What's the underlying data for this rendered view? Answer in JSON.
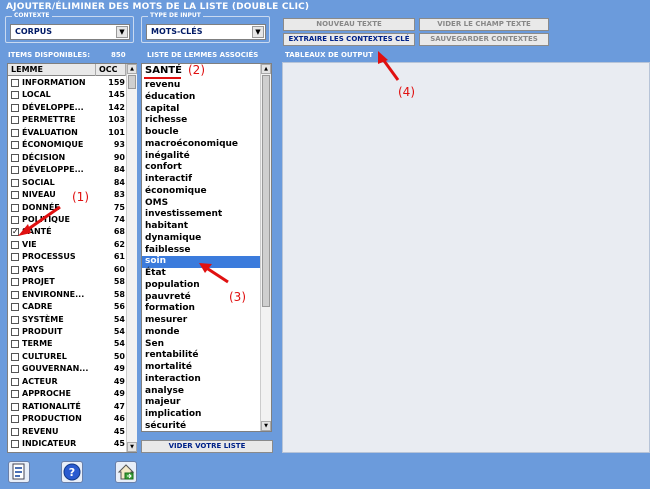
{
  "title": "AJOUTER/ÉLIMINER DES MOTS DE LA LISTE (DOUBLE CLIC)",
  "contexte": {
    "legend": "CONTEXTE",
    "value": "CORPUS"
  },
  "type_input": {
    "legend": "TYPE DE INPUT",
    "value": "MOTS-CLÉS"
  },
  "buttons": {
    "nouveau_texte": "NOUVEAU TEXTE",
    "vider_champ": "VIDER LE CHAMP TEXTE",
    "extraire": "EXTRAIRE LES CONTEXTES CLÉ",
    "sauvegarder": "SAUVEGARDER CONTEXTES",
    "vider_liste": "VIDER VOTRE LISTE"
  },
  "items_label": "ITEMS DISPONIBLES:",
  "items_count": "850",
  "lemmes_label": "LISTE DE LEMMES ASSOCIÉS",
  "output_label": "TABLEAUX DE OUTPUT",
  "columns": {
    "lemme": "LEMME",
    "occ": "OCC"
  },
  "items": [
    {
      "label": "INFORMATION",
      "occ": "159",
      "checked": false
    },
    {
      "label": "LOCAL",
      "occ": "145",
      "checked": false
    },
    {
      "label": "DÉVELOPPE...",
      "occ": "142",
      "checked": false
    },
    {
      "label": "PERMETTRE",
      "occ": "103",
      "checked": false
    },
    {
      "label": "ÉVALUATION",
      "occ": "101",
      "checked": false
    },
    {
      "label": "ÉCONOMIQUE",
      "occ": "93",
      "checked": false
    },
    {
      "label": "DÉCISION",
      "occ": "90",
      "checked": false
    },
    {
      "label": "DÉVELOPPE...",
      "occ": "84",
      "checked": false
    },
    {
      "label": "SOCIAL",
      "occ": "84",
      "checked": false
    },
    {
      "label": "NIVEAU",
      "occ": "83",
      "checked": false
    },
    {
      "label": "DONNÉE",
      "occ": "75",
      "checked": false
    },
    {
      "label": "POLITIQUE",
      "occ": "74",
      "checked": false
    },
    {
      "label": "SANTÉ",
      "occ": "68",
      "checked": true
    },
    {
      "label": "VIE",
      "occ": "62",
      "checked": false
    },
    {
      "label": "PROCESSUS",
      "occ": "61",
      "checked": false
    },
    {
      "label": "PAYS",
      "occ": "60",
      "checked": false
    },
    {
      "label": "PROJET",
      "occ": "58",
      "checked": false
    },
    {
      "label": "ENVIRONNE...",
      "occ": "58",
      "checked": false
    },
    {
      "label": "CADRE",
      "occ": "56",
      "checked": false
    },
    {
      "label": "SYSTÈME",
      "occ": "54",
      "checked": false
    },
    {
      "label": "PRODUIT",
      "occ": "54",
      "checked": false
    },
    {
      "label": "TERME",
      "occ": "54",
      "checked": false
    },
    {
      "label": "CULTUREL",
      "occ": "50",
      "checked": false
    },
    {
      "label": "GOUVERNAN...",
      "occ": "49",
      "checked": false
    },
    {
      "label": "ACTEUR",
      "occ": "49",
      "checked": false
    },
    {
      "label": "APPROCHE",
      "occ": "49",
      "checked": false
    },
    {
      "label": "RATIONALITÉ",
      "occ": "47",
      "checked": false
    },
    {
      "label": "PRODUCTION",
      "occ": "46",
      "checked": false
    },
    {
      "label": "REVENU",
      "occ": "45",
      "checked": false
    },
    {
      "label": "INDICATEUR",
      "occ": "45",
      "checked": false
    }
  ],
  "lemma_header": "SANTÉ",
  "lemmas": [
    "revenu",
    "éducation",
    "capital",
    "richesse",
    "boucle",
    "macroéconomique",
    "inégalité",
    "confort",
    "interactif",
    "économique",
    "OMS",
    "investissement",
    "habitant",
    "dynamique",
    "faiblesse",
    "soin",
    "État",
    "population",
    "pauvreté",
    "formation",
    "mesurer",
    "monde",
    "Sen",
    "rentabilité",
    "mortalité",
    "interaction",
    "analyse",
    "majeur",
    "implication",
    "sécurité"
  ],
  "selected_lemma": "soin",
  "annotations": [
    "(1)",
    "(2)",
    "(3)",
    "(4)"
  ],
  "icons": [
    "report-icon",
    "help-icon",
    "home-icon"
  ],
  "colors": {
    "background": "#6b9bdc",
    "selection": "#3b7bdc",
    "annotation": "#e01010"
  }
}
